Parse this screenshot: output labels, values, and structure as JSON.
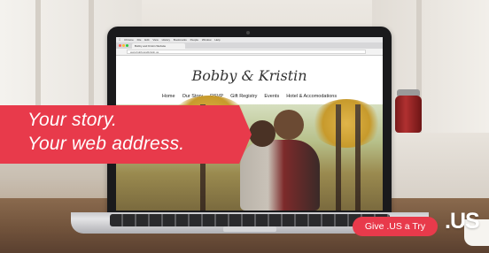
{
  "mac_menubar": {
    "items": [
      "Chrome",
      "File",
      "Edit",
      "View",
      "History",
      "Bookmarks",
      "People",
      "Window",
      "Help"
    ]
  },
  "browser": {
    "tab_title": "Bobby and Kristin Website",
    "url": "www.bobbyandkristin.us"
  },
  "site": {
    "title": "Bobby & Kristin",
    "nav": [
      "Home",
      "Our Story",
      "RSVP",
      "Gift Registry",
      "Events",
      "Hotel & Accomodations"
    ]
  },
  "ad": {
    "headline_line1": "Your story.",
    "headline_line2": "Your web address.",
    "cta_label": "Give .US a Try",
    "brand": ".US"
  },
  "colors": {
    "accent": "#e83a4b"
  }
}
